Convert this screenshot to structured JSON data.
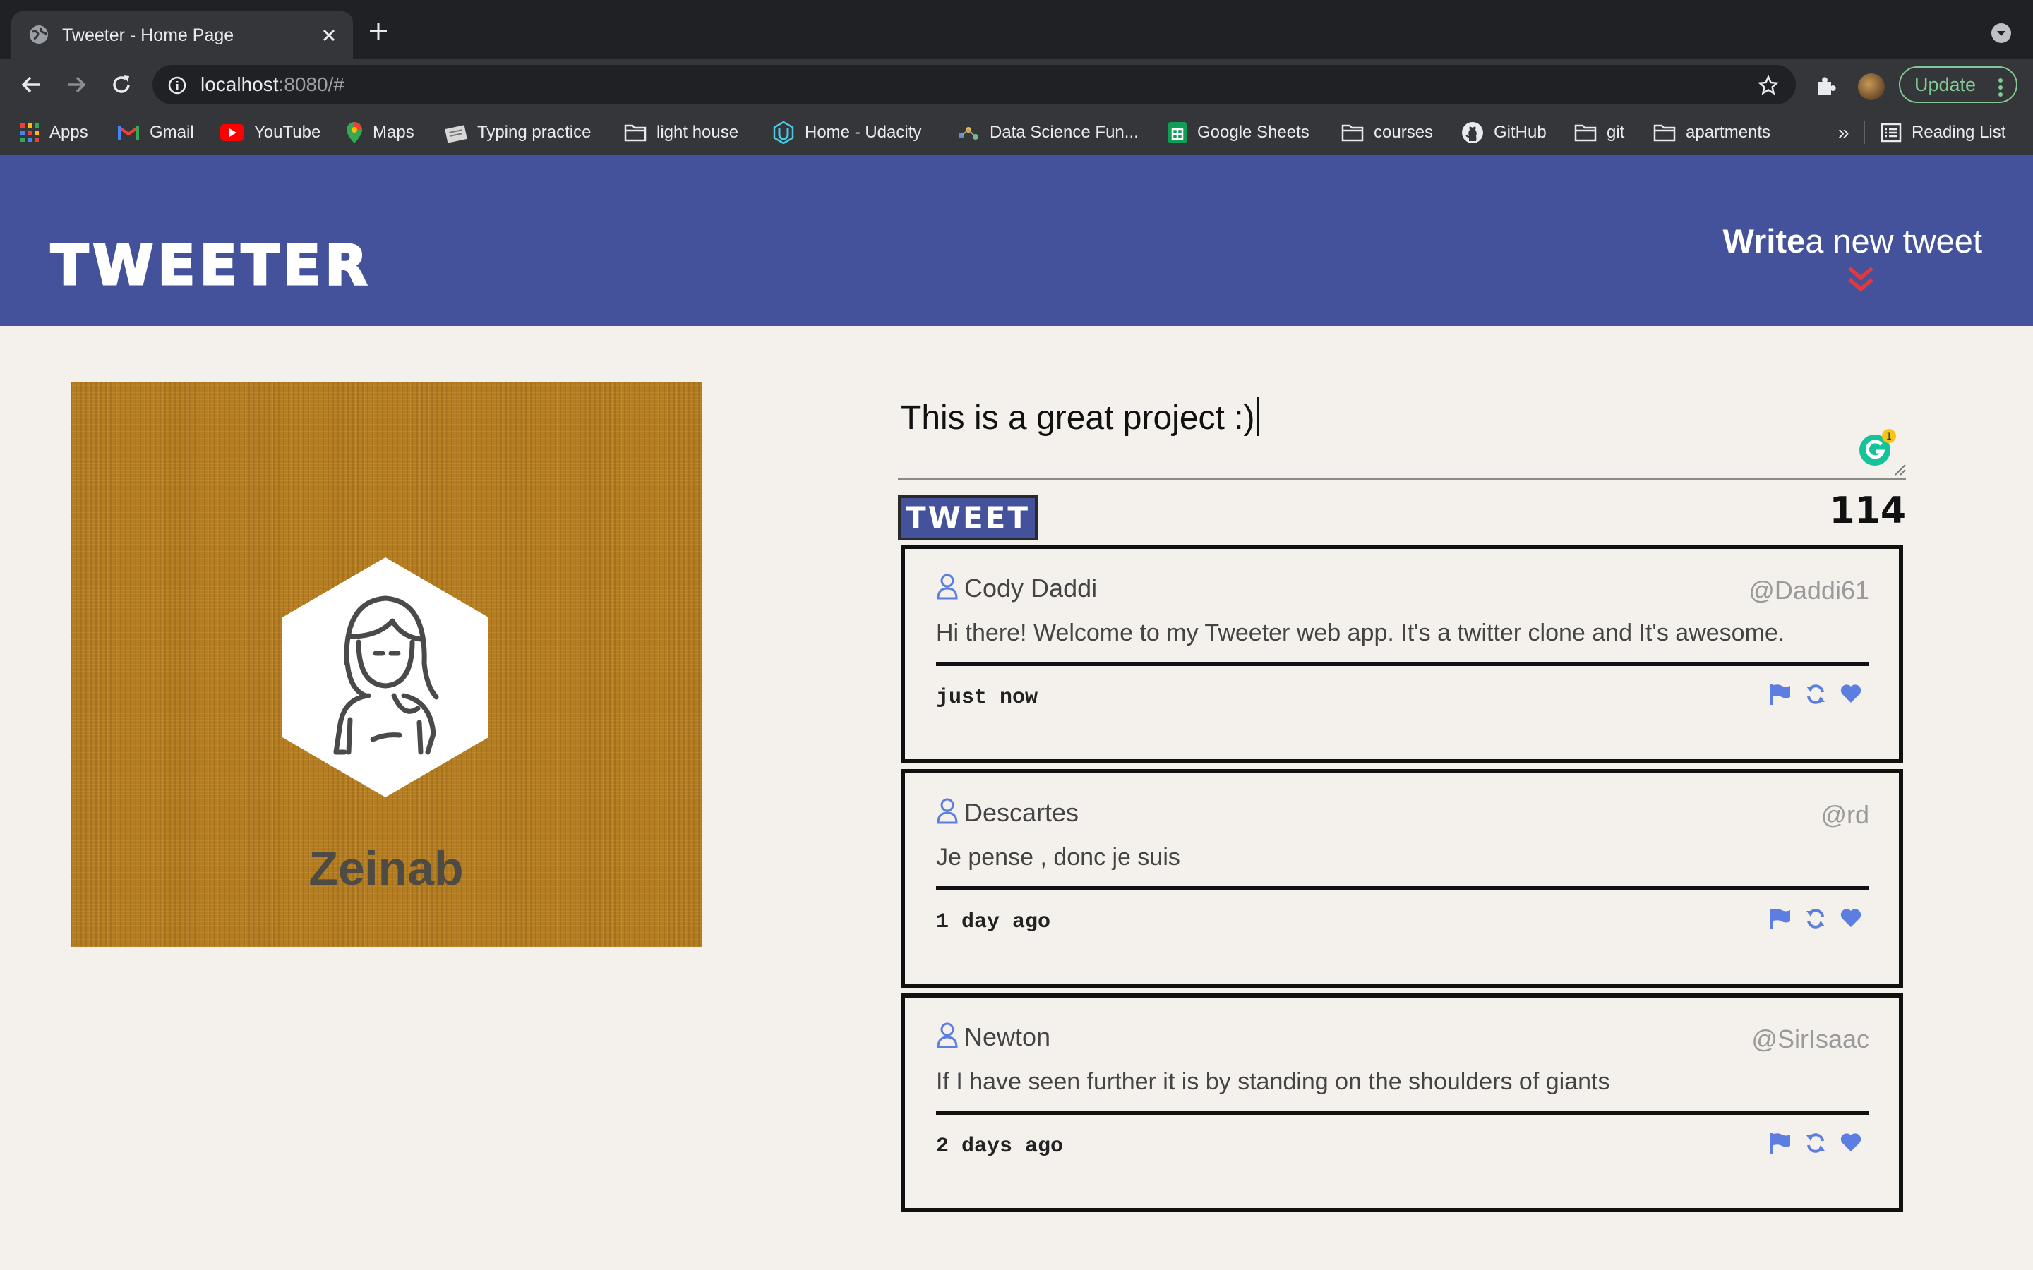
{
  "browser": {
    "tab_title": "Tweeter - Home Page",
    "url_host": "localhost",
    "url_rest": ":8080/#",
    "update_label": "Update",
    "bookmarks": [
      {
        "label": "Apps",
        "icon": "apps-grid-icon"
      },
      {
        "label": "Gmail",
        "icon": "gmail-icon"
      },
      {
        "label": "YouTube",
        "icon": "youtube-icon"
      },
      {
        "label": "Maps",
        "icon": "maps-icon"
      },
      {
        "label": "Typing practice",
        "icon": "typing-icon"
      },
      {
        "label": "light house",
        "icon": "folder-icon"
      },
      {
        "label": "Home - Udacity",
        "icon": "udacity-icon"
      },
      {
        "label": "Data Science Fun...",
        "icon": "data-science-icon"
      },
      {
        "label": "Google Sheets",
        "icon": "sheets-icon"
      },
      {
        "label": "courses",
        "icon": "folder-icon"
      },
      {
        "label": "GitHub",
        "icon": "github-icon"
      },
      {
        "label": "git",
        "icon": "folder-icon"
      },
      {
        "label": "apartments",
        "icon": "folder-icon"
      }
    ],
    "more_label": "»",
    "reading_list": "Reading List"
  },
  "header": {
    "logo": "TWEETER",
    "compose_bold": "Write",
    "compose_rest": "a new tweet"
  },
  "profile": {
    "name": "Zeinab"
  },
  "compose": {
    "text": "This is a great project :)",
    "button_label": "TWEET",
    "counter": "114",
    "grammarly_badge": "1"
  },
  "tweets": [
    {
      "name": "Cody Daddi",
      "handle": "@Daddi61",
      "text": "Hi there! Welcome to my Tweeter web app. It's a twitter clone and It's awesome.",
      "time": "just now"
    },
    {
      "name": "Descartes",
      "handle": "@rd",
      "text": "Je pense , donc je suis",
      "time": "1 day ago"
    },
    {
      "name": "Newton",
      "handle": "@SirIsaac",
      "text": "If I have seen further it is by standing on the shoulders of giants",
      "time": "2 days ago"
    }
  ],
  "colors": {
    "header_bg": "#44529c",
    "page_bg": "#f4f1ed",
    "action_icon": "#5b7ee0",
    "compose_arrow": "#e0393e"
  }
}
